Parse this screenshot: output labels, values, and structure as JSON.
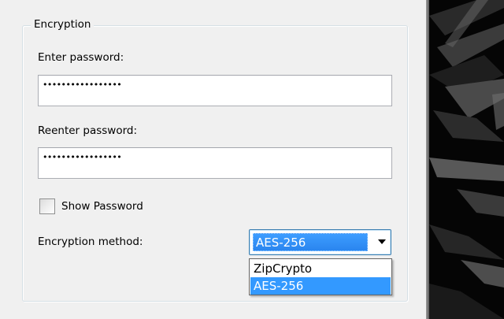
{
  "encryption_group": {
    "title": "Encryption",
    "enter_password_label": "Enter password:",
    "enter_password_value": "•••••••••••••••••",
    "reenter_password_label": "Reenter password:",
    "reenter_password_value": "•••••••••••••••••",
    "show_password_label": "Show Password",
    "show_password_checked": false,
    "method_label": "Encryption method:",
    "method_selected": "AES-256",
    "method_options": [
      "ZipCrypto",
      "AES-256"
    ]
  }
}
